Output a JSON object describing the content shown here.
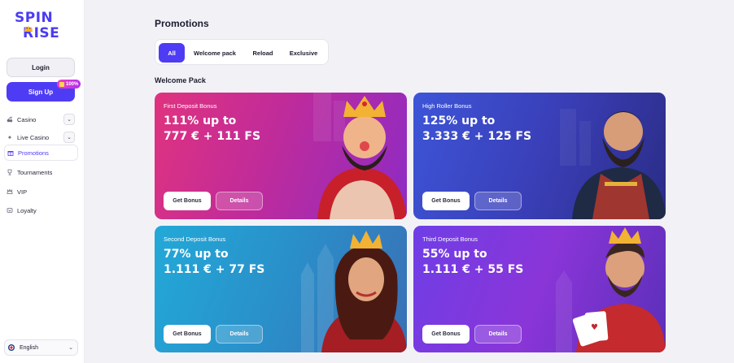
{
  "brand": {
    "logo_line1": "SPIN",
    "logo_line2": "RISE",
    "logo_color": "#4a3cf2"
  },
  "auth": {
    "login_label": "Login",
    "signup_label": "Sign Up",
    "signup_badge": "100%"
  },
  "nav": {
    "items": [
      {
        "label": "Casino",
        "icon": "cherry-icon",
        "expandable": true
      },
      {
        "label": "Live Casino",
        "icon": "spade-icon",
        "expandable": true
      },
      {
        "label": "Promotions",
        "icon": "gift-icon",
        "expandable": false,
        "active": true
      },
      {
        "label": "Tournaments",
        "icon": "trophy-icon",
        "expandable": false
      },
      {
        "label": "VIP",
        "icon": "crown-icon",
        "expandable": false
      },
      {
        "label": "Loyalty",
        "icon": "loyalty-icon",
        "expandable": false
      }
    ]
  },
  "language": {
    "label": "English",
    "icon": "uk-flag-icon"
  },
  "main": {
    "title": "Promotions",
    "tabs": [
      {
        "label": "All",
        "active": true
      },
      {
        "label": "Welcome pack",
        "active": false
      },
      {
        "label": "Reload",
        "active": false
      },
      {
        "label": "Exclusive",
        "active": false
      }
    ],
    "section_title": "Welcome Pack",
    "cards": [
      {
        "label": "First Deposit Bonus",
        "line1": "111% up to",
        "line2": "777 € + 111 FS",
        "get_label": "Get Bonus",
        "details_label": "Details",
        "art": "king-character"
      },
      {
        "label": "High Roller Bonus",
        "line1": "125% up to",
        "line2": "3.333 € + 125 FS",
        "get_label": "Get Bonus",
        "details_label": "Details",
        "art": "captain-character"
      },
      {
        "label": "Second Deposit Bonus",
        "line1": "77% up to",
        "line2": "1.111 € + 77 FS",
        "get_label": "Get Bonus",
        "details_label": "Details",
        "art": "queen-character"
      },
      {
        "label": "Third Deposit Bonus",
        "line1": "55% up to",
        "line2": "1.111 € + 55 FS",
        "get_label": "Get Bonus",
        "details_label": "Details",
        "art": "jack-character"
      }
    ]
  },
  "colors": {
    "accent": "#4e3cf4",
    "card_pink": "#e0337f",
    "card_blue": "#3d55d8",
    "card_cyan": "#22a9d8",
    "card_purple": "#6f3ee6"
  }
}
